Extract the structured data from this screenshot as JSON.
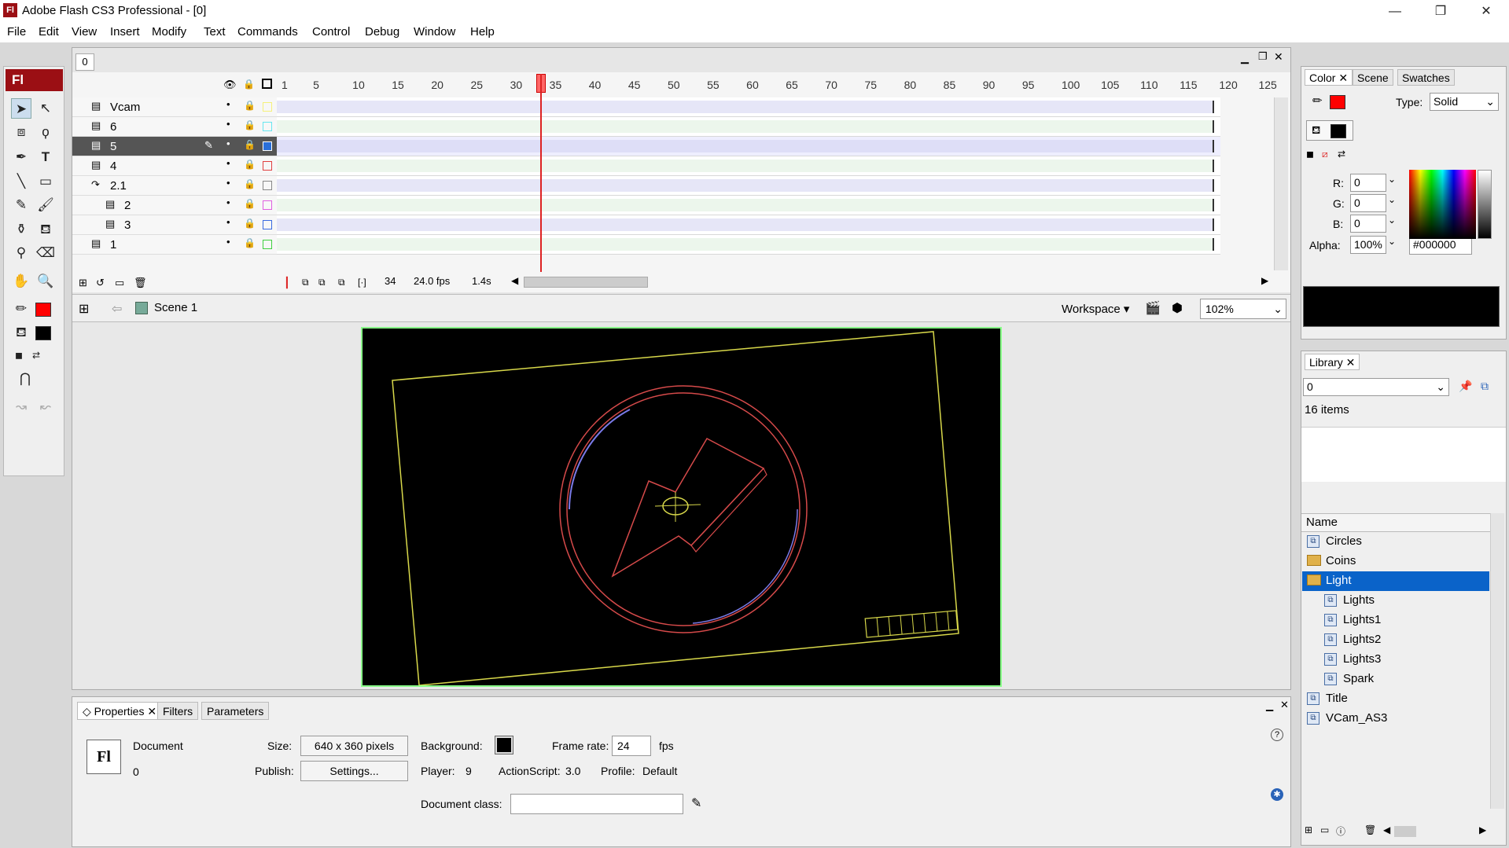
{
  "window": {
    "title": "Adobe Flash CS3 Professional - [0]",
    "app_icon": "Fl",
    "minimize": "—",
    "restore": "❐",
    "close": "✕"
  },
  "menu": [
    "File",
    "Edit",
    "View",
    "Insert",
    "Modify",
    "Text",
    "Commands",
    "Control",
    "Debug",
    "Window",
    "Help"
  ],
  "toolbox": {
    "logo": "Fl"
  },
  "document": {
    "tab": "0"
  },
  "timeline": {
    "ticks": [
      "1",
      "5",
      "10",
      "15",
      "20",
      "25",
      "30",
      "35",
      "40",
      "45",
      "50",
      "55",
      "60",
      "65",
      "70",
      "75",
      "80",
      "85",
      "90",
      "95",
      "100",
      "105",
      "110",
      "115",
      "120",
      "125"
    ],
    "current_frame": "34",
    "fps": "24.0 fps",
    "time": "1.4s",
    "layers": [
      {
        "name": "Vcam",
        "color": "#f5f07a"
      },
      {
        "name": "6",
        "color": "#67e6f0"
      },
      {
        "name": "5",
        "color": "#2a6fd8",
        "selected": true
      },
      {
        "name": "4",
        "color": "#e04040"
      },
      {
        "name": "2.1",
        "color": "#888888"
      },
      {
        "name": "2",
        "color": "#e060e0"
      },
      {
        "name": "3",
        "color": "#3a6ae0"
      },
      {
        "name": "1",
        "color": "#40d040"
      }
    ]
  },
  "editbar": {
    "scene": "Scene 1",
    "workspace": "Workspace",
    "zoom": "102%"
  },
  "properties": {
    "tabs": [
      "Properties",
      "Filters",
      "Parameters"
    ],
    "doc_label": "Document",
    "doc_name": "0",
    "doc_icon": "Fl",
    "size_label": "Size:",
    "size_value": "640 x 360 pixels",
    "background_label": "Background:",
    "framerate_label": "Frame rate:",
    "framerate_value": "24",
    "fps_unit": "fps",
    "publish_label": "Publish:",
    "settings_button": "Settings...",
    "player_label": "Player:",
    "player_value": "9",
    "actionscript_label": "ActionScript:",
    "actionscript_value": "3.0",
    "profile_label": "Profile:",
    "profile_value": "Default",
    "docclass_label": "Document class:",
    "docclass_value": ""
  },
  "color_panel": {
    "tabs": [
      "Color",
      "Scene",
      "Swatches"
    ],
    "type_label": "Type:",
    "type_value": "Solid",
    "r_label": "R:",
    "r_value": "0",
    "g_label": "G:",
    "g_value": "0",
    "b_label": "B:",
    "b_value": "0",
    "alpha_label": "Alpha:",
    "alpha_value": "100%",
    "hex_value": "#000000",
    "stroke_color": "#ff0000",
    "fill_color": "#000000"
  },
  "library": {
    "tab": "Library",
    "doc_select": "0",
    "count": "16 items",
    "name_header": "Name",
    "items": [
      {
        "name": "Circles",
        "type": "symbol",
        "indent": 0
      },
      {
        "name": "Coins",
        "type": "folder",
        "indent": 0
      },
      {
        "name": "Light",
        "type": "folder-open",
        "indent": 0,
        "selected": true
      },
      {
        "name": "Lights",
        "type": "symbol",
        "indent": 1
      },
      {
        "name": "Lights1",
        "type": "symbol",
        "indent": 1
      },
      {
        "name": "Lights2",
        "type": "symbol",
        "indent": 1
      },
      {
        "name": "Lights3",
        "type": "symbol",
        "indent": 1
      },
      {
        "name": "Spark",
        "type": "symbol",
        "indent": 1
      },
      {
        "name": "Title",
        "type": "symbol",
        "indent": 0
      },
      {
        "name": "VCam_AS3",
        "type": "symbol",
        "indent": 0
      }
    ]
  }
}
